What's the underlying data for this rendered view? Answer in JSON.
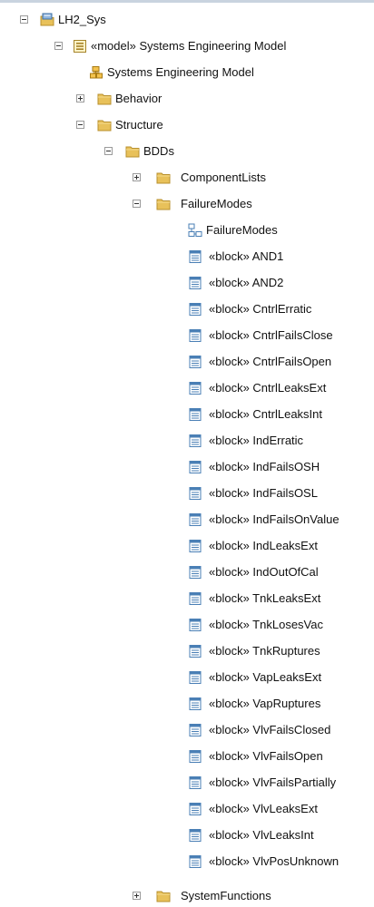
{
  "tree": {
    "root": {
      "label": "LH2_Sys",
      "icon": "package-root-icon"
    },
    "model": {
      "label": "«model» Systems Engineering Model",
      "icon": "model-icon"
    },
    "model_element": {
      "label": "Systems Engineering Model",
      "icon": "model-element-icon"
    },
    "behavior": {
      "label": "Behavior",
      "icon": "folder-icon"
    },
    "structure": {
      "label": "Structure",
      "icon": "folder-icon"
    },
    "bdds": {
      "label": "BDDs",
      "icon": "folder-icon"
    },
    "component_lists": {
      "label": "ComponentLists",
      "icon": "folder-icon"
    },
    "failure_modes": {
      "label": "FailureModes",
      "icon": "folder-icon"
    },
    "failure_modes_diagram": {
      "label": "FailureModes",
      "icon": "diagram-icon"
    },
    "blocks": [
      {
        "label": "«block» AND1"
      },
      {
        "label": "«block» AND2"
      },
      {
        "label": "«block» CntrlErratic"
      },
      {
        "label": "«block» CntrlFailsClose"
      },
      {
        "label": "«block» CntrlFailsOpen"
      },
      {
        "label": "«block» CntrlLeaksExt"
      },
      {
        "label": "«block» CntrlLeaksInt"
      },
      {
        "label": "«block» IndErratic"
      },
      {
        "label": "«block» IndFailsOSH"
      },
      {
        "label": "«block» IndFailsOSL"
      },
      {
        "label": "«block» IndFailsOnValue"
      },
      {
        "label": "«block» IndLeaksExt"
      },
      {
        "label": "«block» IndOutOfCal"
      },
      {
        "label": "«block» TnkLeaksExt"
      },
      {
        "label": "«block» TnkLosesVac"
      },
      {
        "label": "«block» TnkRuptures"
      },
      {
        "label": "«block» VapLeaksExt"
      },
      {
        "label": "«block» VapRuptures"
      },
      {
        "label": "«block» VlvFailsClosed"
      },
      {
        "label": "«block» VlvFailsOpen"
      },
      {
        "label": "«block» VlvFailsPartially"
      },
      {
        "label": "«block» VlvLeaksExt"
      },
      {
        "label": "«block» VlvLeaksInt"
      },
      {
        "label": "«block» VlvPosUnknown"
      }
    ],
    "system_functions": {
      "label": "SystemFunctions",
      "icon": "folder-icon"
    }
  },
  "colors": {
    "folder": "#e8c15a",
    "folder_edge": "#b8902e",
    "block_icon": "#4a7fb5",
    "expander_border": "#9a9a9a"
  }
}
